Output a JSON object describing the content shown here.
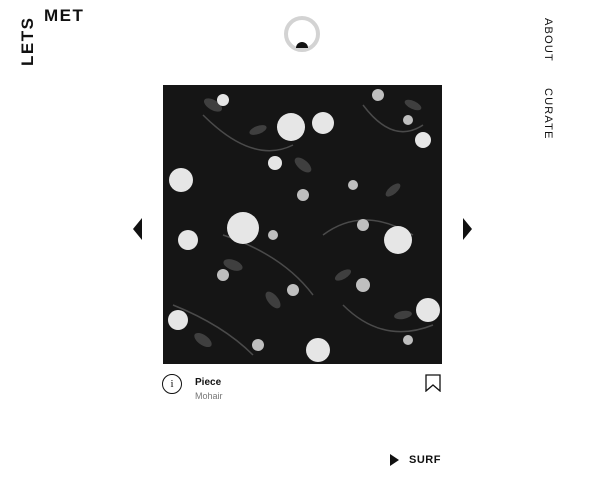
{
  "logo": {
    "lets": "LETS",
    "met": "MET"
  },
  "nav": {
    "about": "ABOUT",
    "curate": "CURATE"
  },
  "artwork": {
    "title": "Piece",
    "medium": "Mohair"
  },
  "info": {
    "glyph": "i"
  },
  "surf": {
    "label": "SURF"
  },
  "icons": {
    "dial": "loading-dial-icon",
    "prev": "previous-arrow-icon",
    "next": "next-arrow-icon",
    "info": "info-icon",
    "bookmark": "bookmark-icon",
    "play": "play-icon"
  },
  "colors": {
    "background": "#ffffff",
    "text": "#111111",
    "muted": "#777777",
    "artwork_bg": "#151515"
  }
}
